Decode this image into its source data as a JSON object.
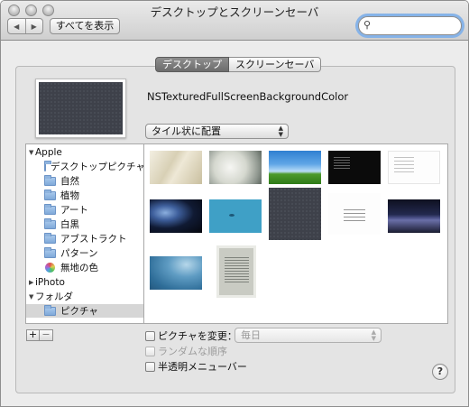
{
  "window": {
    "title": "デスクトップとスクリーンセーバ"
  },
  "toolbar": {
    "back_icon": "◀",
    "forward_icon": "▶",
    "show_all_label": "すべてを表示",
    "search_value": "",
    "search_placeholder": ""
  },
  "tabs": [
    {
      "label": "デスクトップ",
      "selected": true
    },
    {
      "label": "スクリーンセーバ",
      "selected": false
    }
  ],
  "desktop": {
    "current_background_name": "NSTexturedFullScreenBackgroundColor",
    "fill_mode": "タイル状に配置"
  },
  "sources": {
    "apple_header": "Apple",
    "apple_items": [
      "デスクトップピクチャ",
      "自然",
      "植物",
      "アート",
      "白黒",
      "アブストラクト",
      "パターン",
      "無地の色"
    ],
    "iphoto_header": "iPhoto",
    "folders_header": "フォルダ",
    "folders_items": [
      "ピクチャ"
    ],
    "selected_item": "ピクチャ"
  },
  "controls": {
    "add_label": "+",
    "remove_label": "−",
    "change_picture_label": "ピクチャを変更：",
    "change_interval_value": "毎日",
    "random_order_label": "ランダムな順序",
    "translucent_menu_label": "半透明メニューバー",
    "help_label": "?"
  },
  "colors": {
    "tab_active": "#7a7a7a",
    "selection_gray": "#d6d6d6",
    "search_focus_ring": "#86b3e8"
  },
  "icons": {
    "search": "magnifier-icon",
    "folder": "folder-icon",
    "colors": "color-wheel-icon"
  }
}
